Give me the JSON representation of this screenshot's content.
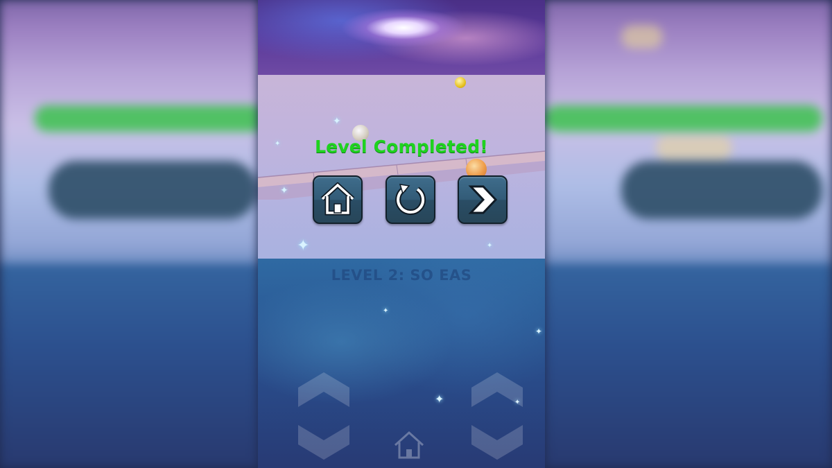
{
  "overlay": {
    "title": "Level Completed!"
  },
  "buttons": {
    "home": {
      "icon": "home-icon"
    },
    "restart": {
      "icon": "restart-icon"
    },
    "next": {
      "icon": "chevron-right-icon"
    }
  },
  "background": {
    "level_label": "LEVEL 2: SO EAS"
  },
  "controls": {
    "left_icon": "chevron-up-down-icon",
    "center_icon": "home-icon",
    "right_icon": "chevron-up-down-icon"
  },
  "colors": {
    "title_green": "#1fd31f",
    "button_face": "#325b77",
    "button_border": "#12202b",
    "icon_white": "#ffffff"
  }
}
